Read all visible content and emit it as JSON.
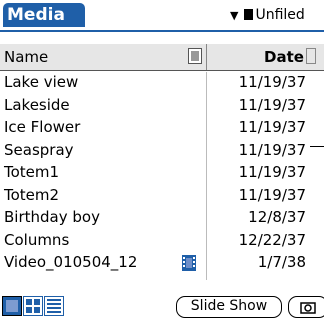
{
  "app": {
    "title": "Media"
  },
  "category": {
    "label": "Unfiled"
  },
  "columns": {
    "name": "Name",
    "date": "Date"
  },
  "rows": [
    {
      "name": "Lake view",
      "date": "11/19/37",
      "video": false
    },
    {
      "name": "Lakeside",
      "date": "11/19/37",
      "video": false
    },
    {
      "name": "Ice Flower",
      "date": "11/19/37",
      "video": false
    },
    {
      "name": "Seaspray",
      "date": "11/19/37",
      "video": false
    },
    {
      "name": "Totem1",
      "date": "11/19/37",
      "video": false
    },
    {
      "name": "Totem2",
      "date": "11/19/37",
      "video": false
    },
    {
      "name": "Birthday boy",
      "date": "12/8/37",
      "video": false
    },
    {
      "name": "Columns",
      "date": "12/22/37",
      "video": false
    },
    {
      "name": "Video_010504_12",
      "date": "1/7/38",
      "video": true
    }
  ],
  "toolbar": {
    "slideshow_label": "Slide Show"
  },
  "colors": {
    "accent": "#1f5fa8"
  }
}
